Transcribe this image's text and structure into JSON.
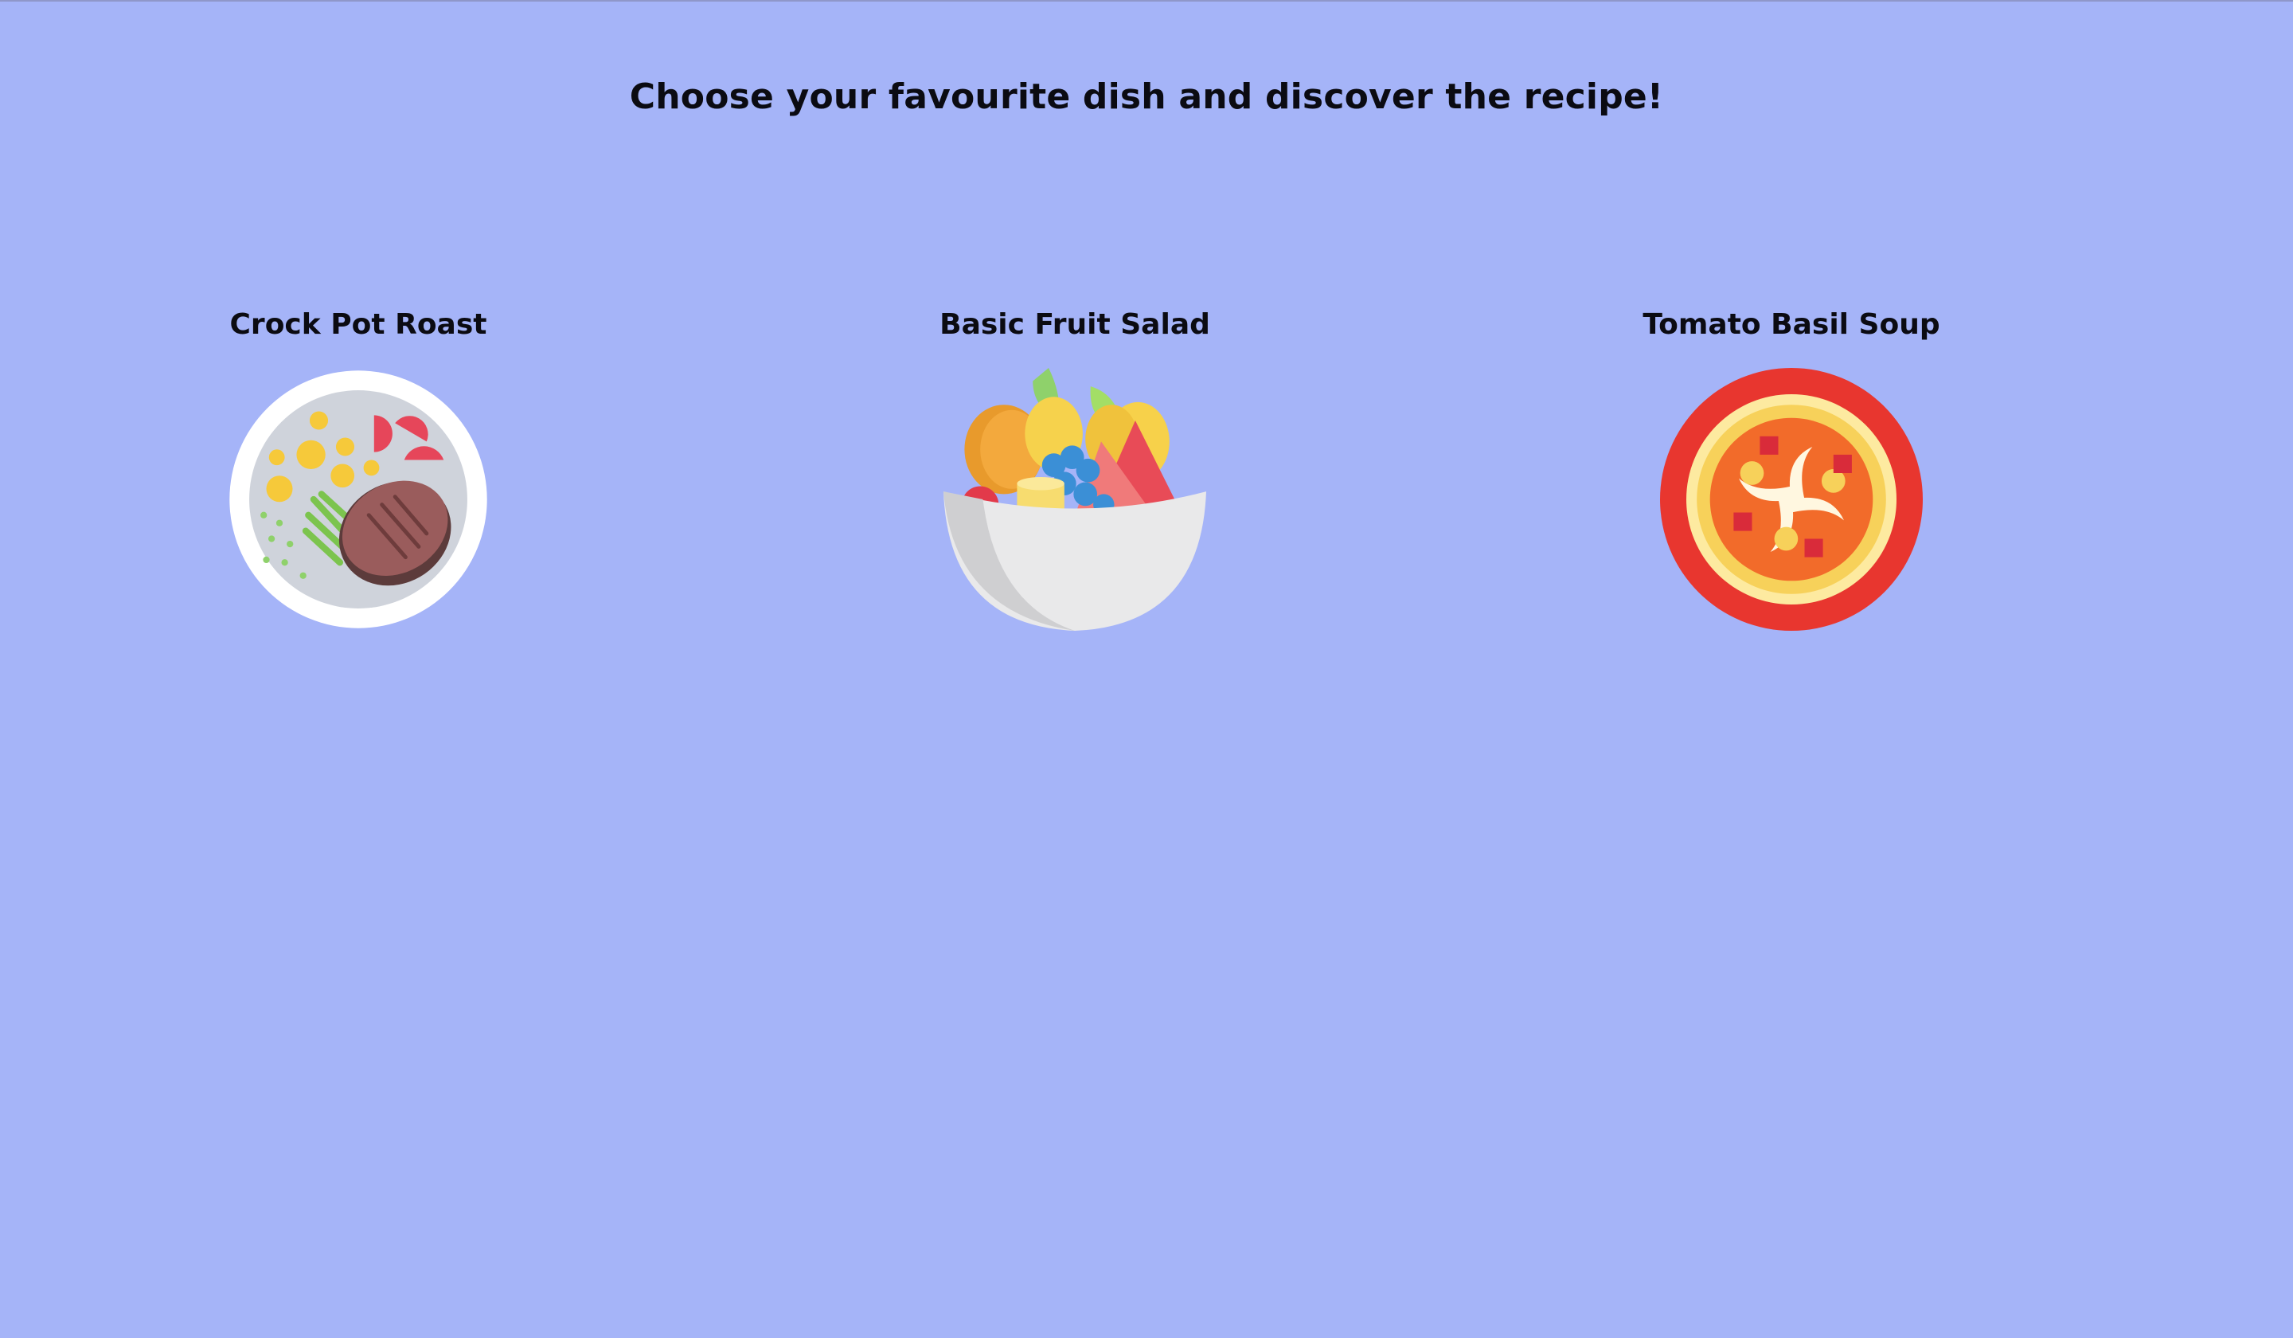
{
  "page": {
    "title": "Choose your favourite dish and discover the recipe!",
    "background": "#a5b4f8",
    "faded_text_color": "#aebcf4"
  },
  "dishes": [
    {
      "name": "Crock Pot Roast",
      "image_icon": "plate-roast-icon"
    },
    {
      "name": "Basic Fruit Salad",
      "image_icon": "fruit-bowl-icon"
    },
    {
      "name": "Tomato Basil Soup",
      "image_icon": "soup-bowl-icon"
    }
  ]
}
